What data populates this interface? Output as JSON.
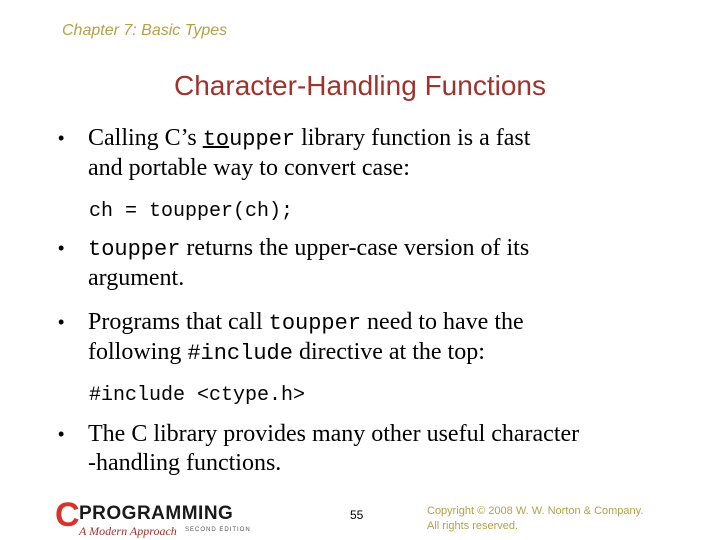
{
  "header": {
    "chapter": "Chapter 7: Basic Types",
    "title": "Character-Handling Functions"
  },
  "bullets": [
    {
      "line1_pre": "Calling C’s ",
      "line1_code_selected": "to",
      "line1_code_rest": "upper",
      "line1_post": " library function is a fast",
      "line2": "and portable way to convert case:"
    },
    {
      "line1_code": "toupper",
      "line1_post": " returns the upper-case version of its",
      "line2": "argument."
    },
    {
      "line1_pre": "Programs that call ",
      "line1_code": "toupper",
      "line1_post": " need to have the",
      "line2_pre": "following ",
      "line2_code": "#include",
      "line2_post": " directive at the top:"
    },
    {
      "line1": "The C library provides many other useful character",
      "line2": "-handling functions."
    }
  ],
  "code": {
    "example1": "ch = toupper(ch);",
    "example2": "#include <ctype.h>"
  },
  "bullet_glyph": "•",
  "footer": {
    "logo_c": "C",
    "logo_title": "PROGRAMMING",
    "logo_subtitle": "A Modern Approach",
    "logo_edition": "SECOND EDITION",
    "page_number": "55",
    "copyright_line1": "Copyright © 2008 W. W. Norton & Company.",
    "copyright_line2": "All rights reserved."
  },
  "colors": {
    "chapter": "#b5a046",
    "title": "#a0322c",
    "logo_accent": "#d9322a"
  }
}
